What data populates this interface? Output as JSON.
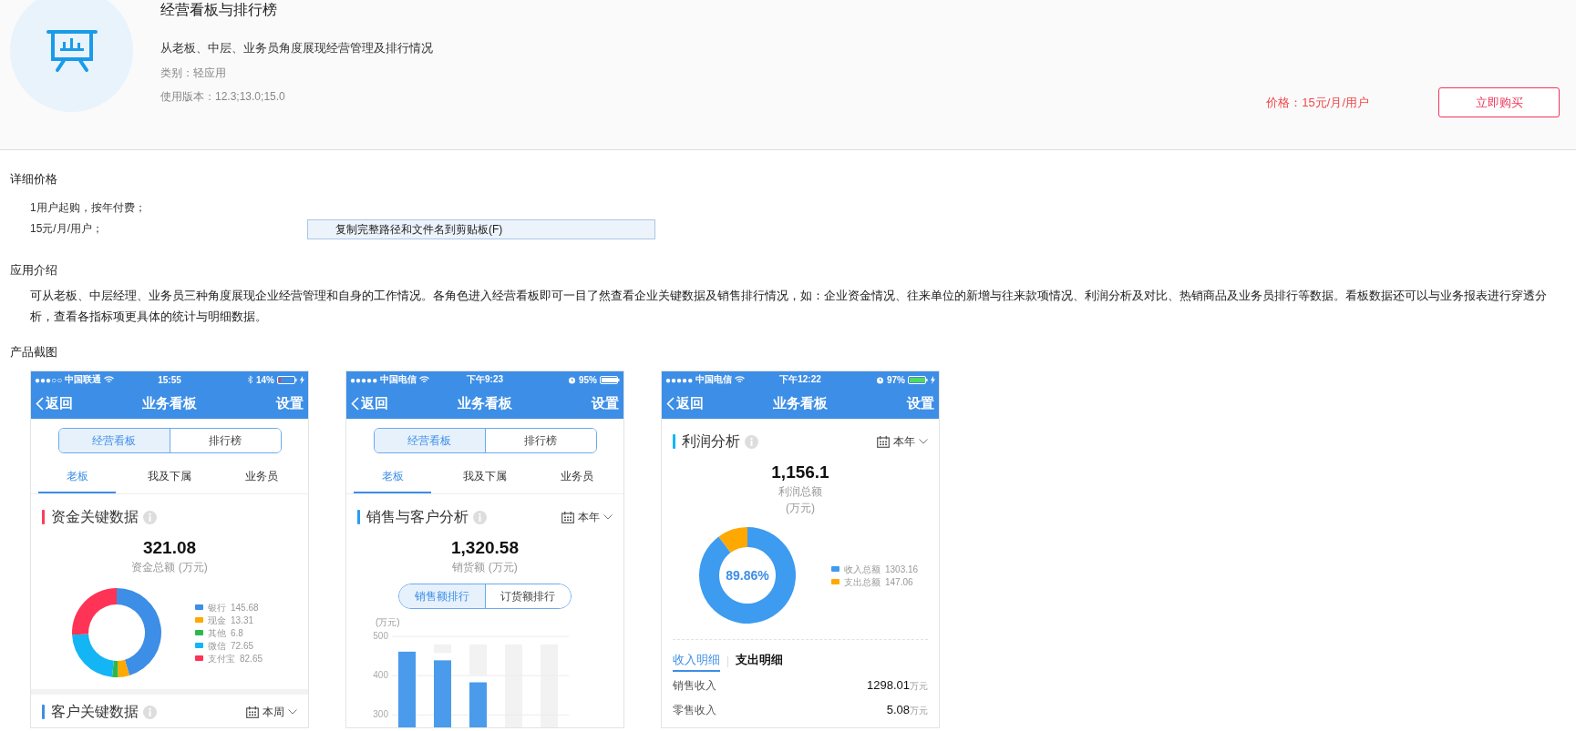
{
  "app": {
    "title": "经营看板与排行榜",
    "description": "从老板、中层、业务员角度展现经营管理及排行情况",
    "category": "类别：轻应用",
    "versions": "使用版本：12.3;13.0;15.0",
    "price": "价格：15元/月/用户",
    "buy_button": "立即购买"
  },
  "pricing": {
    "heading": "详细价格",
    "lines": [
      "1用户起购，按年付费；",
      "15元/月/用户；"
    ],
    "tooltip": "复制完整路径和文件名到剪贴板(F)"
  },
  "intro": {
    "heading": "应用介绍",
    "text": "可从老板、中层经理、业务员三种角度展现企业经营管理和自身的工作情况。各角色进入经营看板即可一目了然查看企业关键数据及销售排行情况，如：企业资金情况、往来单位的新增与往来款项情况、利润分析及对比、热销商品及业务员排行等数据。看板数据还可以与业务报表进行穿透分析，查看各指标项更具体的统计与明细数据。"
  },
  "screenshots": {
    "heading": "产品截图",
    "phones": [
      {
        "status": {
          "signal": "●●●○○",
          "carrier": "中国联通",
          "time": "15:55",
          "icons": [
            {
              "kind": "bluetooth"
            }
          ],
          "battery_text": "14%",
          "battery": {
            "kind": "low"
          },
          "charging": true
        },
        "nav": {
          "back": "返回",
          "title": "业务看板",
          "action": "设置"
        },
        "segments": [
          {
            "label": "经营看板",
            "selected": true
          },
          {
            "label": "排行榜",
            "selected": false
          }
        ],
        "tabs": [
          {
            "label": "老板",
            "selected": true
          },
          {
            "label": "我及下属",
            "selected": false
          },
          {
            "label": "业务员",
            "selected": false
          }
        ],
        "sections": [
          {
            "kind": "donut",
            "title": "资金关键数据",
            "color": "#ff3b5c",
            "total": "321.08",
            "total_label": "资金总额 (万元)",
            "chart_data": {
              "type": "donut",
              "categories": [
                "银行",
                "现金",
                "其他",
                "微信",
                "支付宝"
              ],
              "values": [
                145.68,
                13.31,
                6.8,
                72.65,
                82.65
              ],
              "value_labels": [
                "145.68",
                "13.31",
                "6.8",
                "72.65",
                "82.65"
              ],
              "legend": "right",
              "colors": [
                "#3d8ee6",
                "#ffa800",
                "#2eb84b",
                "#13b5f5",
                "#ff3355"
              ]
            }
          },
          {
            "kind": "header",
            "title": "客户关键数据",
            "color": "#3d8ee6",
            "period": "本周"
          }
        ]
      },
      {
        "status": {
          "signal": "●●●●●",
          "carrier": "中国电信",
          "time": "下午9:23",
          "icons": [
            {
              "kind": "alarm"
            }
          ],
          "battery_text": "95%",
          "battery": {
            "kind": "full"
          },
          "charging": false
        },
        "nav": {
          "back": "返回",
          "title": "业务看板",
          "action": "设置"
        },
        "segments": [
          {
            "label": "经营看板",
            "selected": true
          },
          {
            "label": "排行榜",
            "selected": false
          }
        ],
        "tabs": [
          {
            "label": "老板",
            "selected": true
          },
          {
            "label": "我及下属",
            "selected": false
          },
          {
            "label": "业务员",
            "selected": false
          }
        ],
        "sections": [
          {
            "kind": "bars",
            "title": "销售与客户分析",
            "color": "#2a9df4",
            "period": "本年",
            "total": "1,320.58",
            "total_label": "销货额 (万元)",
            "switch": [
              {
                "label": "销售额排行",
                "selected": true
              },
              {
                "label": "订货额排行",
                "selected": false
              }
            ],
            "chart_data": {
              "type": "bar",
              "ylabel": "(万元)",
              "values": [
                461,
                439,
                383,
                null,
                null
              ],
              "ylim": [
                250,
                500
              ],
              "yticks": [
                300,
                400,
                500
              ]
            }
          }
        ]
      },
      {
        "status": {
          "signal": "●●●●●",
          "carrier": "中国电信",
          "time": "下午12:22",
          "icons": [
            {
              "kind": "alarm"
            }
          ],
          "battery_text": "97%",
          "battery": {
            "kind": "charged"
          },
          "charging": true
        },
        "nav": {
          "back": "返回",
          "title": "业务看板",
          "action": "设置"
        },
        "sections": [
          {
            "kind": "donut",
            "title": "利润分析",
            "color": "#13b5f5",
            "period": "本年",
            "total": "1,156.1",
            "total_label": "利润总额",
            "unit": "(万元)",
            "center": "89.86%",
            "chart_data": {
              "type": "donut",
              "categories": [
                "收入总额",
                "支出总额"
              ],
              "values": [
                1303.16,
                147.06
              ],
              "value_labels": [
                "1303.16",
                "147.06"
              ],
              "legend": "right",
              "colors": [
                "#3d9bf0",
                "#ffa800"
              ]
            }
          },
          {
            "kind": "details",
            "tabs": [
              {
                "label": "收入明细",
                "selected": true
              },
              {
                "label": "支出明细",
                "selected": false
              }
            ],
            "rows": [
              {
                "label": "销售收入",
                "value": "1298.01",
                "unit": "万元"
              },
              {
                "label": "零售收入",
                "value": "5.08",
                "unit": "万元"
              }
            ]
          }
        ]
      }
    ]
  }
}
